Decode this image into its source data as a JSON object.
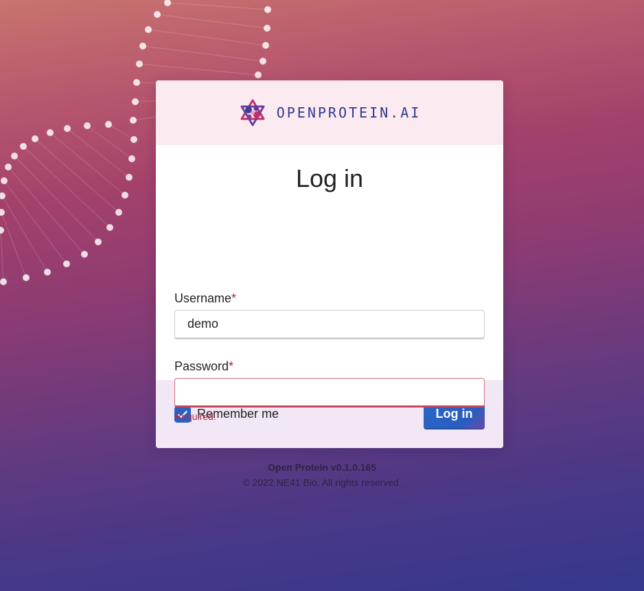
{
  "brand": {
    "name": "OPENPROTEIN.AI",
    "logo_icon": "protein-knot-logo"
  },
  "login": {
    "title": "Log in",
    "username": {
      "label": "Username",
      "required_mark": "*",
      "value": "demo"
    },
    "password": {
      "label": "Password",
      "required_mark": "*",
      "value": "",
      "error": "Required."
    },
    "remember": {
      "label": "Remember me",
      "checked": true,
      "icon": "checkmark-icon"
    },
    "submit_label": "Log in"
  },
  "footer": {
    "version": "Open Protein v0.1.0.165",
    "copyright": "© 2022 NE41 Bio. All rights reserved."
  },
  "colors": {
    "brand_text": "#2f3a8f",
    "primary_button": "#2b62c2",
    "error": "#b4233e",
    "header_bg": "#fceaf1",
    "footer_bg": "#f2e8f5"
  }
}
